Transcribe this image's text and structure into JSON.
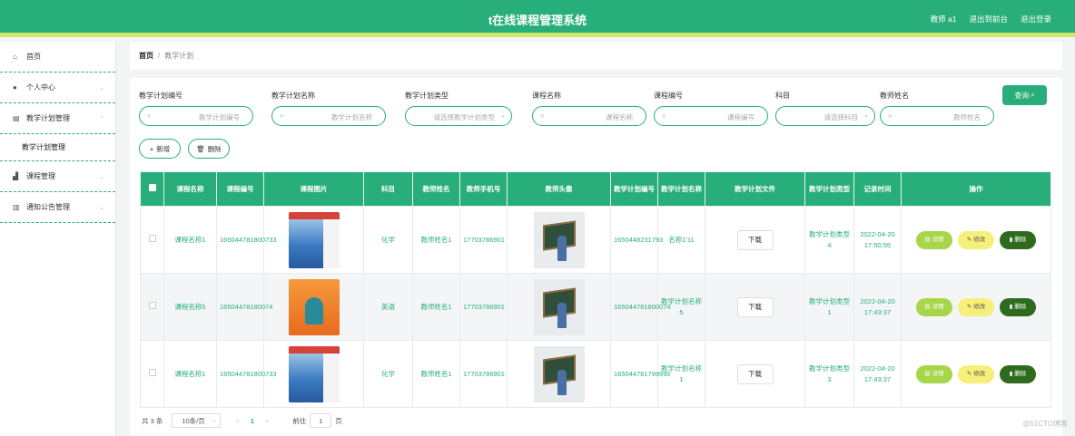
{
  "header": {
    "title": "t在线课程管理系统",
    "user": "教师 a1",
    "back_front": "退出到前台",
    "logout": "退出登录"
  },
  "sidebar": {
    "items": [
      {
        "label": "首页",
        "icon": "home-icon"
      },
      {
        "label": "个人中心",
        "icon": "user-icon"
      },
      {
        "label": "教学计划管理",
        "icon": "clipboard-icon",
        "expanded": true
      },
      {
        "label": "课程管理",
        "icon": "chart-icon"
      },
      {
        "label": "通知公告管理",
        "icon": "bar-chart-icon"
      }
    ],
    "sub_item": "教学计划管理"
  },
  "breadcrumb": {
    "home": "首页",
    "separator": "/",
    "current": "教学计划"
  },
  "filters": [
    {
      "label": "教学计划编号",
      "placeholder": "教学计划编号"
    },
    {
      "label": "教学计划名称",
      "placeholder": "教学计划名称"
    },
    {
      "label": "教学计划类型",
      "placeholder": "请选择教学计划类型"
    },
    {
      "label": "课程名称",
      "placeholder": "课程名称"
    },
    {
      "label": "课程编号",
      "placeholder": "课程编号"
    },
    {
      "label": "科目",
      "placeholder": "请选择科目"
    },
    {
      "label": "教师姓名",
      "placeholder": "教师姓名"
    }
  ],
  "buttons": {
    "query": "查询",
    "add": "新增",
    "delete": "删除"
  },
  "table": {
    "headers": [
      "课程名称",
      "课程编号",
      "课程图片",
      "科目",
      "教师姓名",
      "教师手机号",
      "教师头像",
      "教学计划编号",
      "教学计划名称",
      "教学计划文件",
      "教学计划类型",
      "记录时间",
      "操作"
    ],
    "rows": [
      {
        "course_name": "课程名称1",
        "course_no": "165044781800733",
        "subject": "化学",
        "teacher": "教师姓名1",
        "phone": "17703786901",
        "plan_no": "1650448231793",
        "plan_name": "名称1'11",
        "file_btn": "下载",
        "plan_type": "教学计划类型4",
        "time": "2022-04-20 17:50:55"
      },
      {
        "course_name": "课程名称5",
        "course_no": "16504478180074",
        "subject": "英语",
        "teacher": "教师姓名1",
        "phone": "17703786901",
        "plan_no": "165044781800074",
        "plan_name": "教学计划名称5",
        "file_btn": "下载",
        "plan_type": "教学计划类型1",
        "time": "2022-04-20 17:43:37"
      },
      {
        "course_name": "课程名称1",
        "course_no": "165044781800733",
        "subject": "化学",
        "teacher": "教师姓名1",
        "phone": "17703786901",
        "plan_no": "165044781799990",
        "plan_name": "教学计划名称1",
        "file_btn": "下载",
        "plan_type": "教学计划类型3",
        "time": "2022-04-20 17:43:37"
      }
    ],
    "ops": {
      "detail": "详情",
      "edit": "修改",
      "delete": "删除"
    }
  },
  "pager": {
    "total": "共 3 条",
    "page_size": "10条/页",
    "prev": "<",
    "current": "1",
    "next": ">",
    "goto_label": "前往",
    "goto_value": "1",
    "page_suffix": "页"
  },
  "watermark": "@51CTO博客",
  "colors": {
    "primary": "#27ae7a",
    "accent_bar": "#cde86f",
    "detail_btn": "#a7d64a",
    "edit_btn": "#f6ef7a",
    "delete_btn": "#2e6b1e"
  }
}
